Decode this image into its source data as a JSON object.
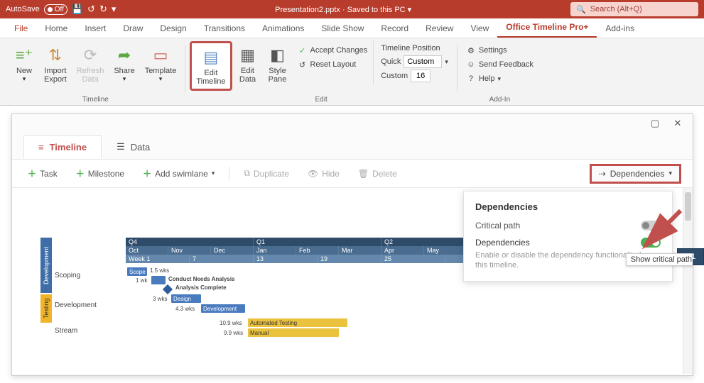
{
  "titlebar": {
    "autosave_label": "AutoSave",
    "autosave_state": "Off",
    "doc_title": "Presentation2.pptx · Saved to this PC ",
    "search_placeholder": "Search (Alt+Q)"
  },
  "ribbon_tabs": [
    "File",
    "Home",
    "Insert",
    "Draw",
    "Design",
    "Transitions",
    "Animations",
    "Slide Show",
    "Record",
    "Review",
    "View",
    "Office Timeline Pro+",
    "Add-ins"
  ],
  "ribbon": {
    "new": "New",
    "import_export": "Import\nExport",
    "refresh_data": "Refresh\nData",
    "share": "Share",
    "template": "Template",
    "group_timeline": "Timeline",
    "edit_timeline": "Edit\nTimeline",
    "edit_data": "Edit\nData",
    "style_pane": "Style\nPane",
    "accept_changes": "Accept Changes",
    "reset_layout": "Reset Layout",
    "timeline_position": "Timeline Position",
    "quick": "Quick",
    "quick_val": "Custom",
    "custom": "Custom",
    "custom_val": "16",
    "group_edit": "Edit",
    "settings": "Settings",
    "send_feedback": "Send Feedback",
    "help": "Help",
    "group_addin": "Add-In"
  },
  "editor": {
    "tab_timeline": "Timeline",
    "tab_data": "Data",
    "task": "Task",
    "milestone": "Milestone",
    "add_swimlane": "Add swimlane",
    "duplicate": "Duplicate",
    "hide": "Hide",
    "delete": "Delete",
    "dependencies_btn": "Dependencies"
  },
  "dep_popup": {
    "title": "Dependencies",
    "critical_path": "Critical path",
    "dependencies": "Dependencies",
    "desc": "Enable or disable the dependency functionality for this timeline.",
    "tooltip": "Show critical path"
  },
  "timescale": {
    "quarters": [
      "Q4",
      "Q1",
      "Q2"
    ],
    "months": [
      "Oct",
      "Nov",
      "Dec",
      "Jan",
      "Feb",
      "Mar",
      "Apr",
      "May"
    ],
    "weeks": [
      "Week 1",
      "7",
      "13",
      "19",
      "25",
      ""
    ]
  },
  "lanes": {
    "dev": "Development",
    "test": "Testing"
  },
  "rows": {
    "scoping": "Scoping",
    "development": "Development",
    "stream": "Stream"
  },
  "tasks": {
    "scope": "Scope",
    "scope_dur": "1.5 wks",
    "cna_dur": "1 wk",
    "conduct_needs": "Conduct Needs Analysis",
    "analysis_complete": "Analysis Complete",
    "design": "Design",
    "design_dur": "3 wks",
    "development": "Development",
    "dev_dur": "4.3 wks",
    "auto_test": "Automated Testing",
    "auto_dur": "10.9 wks",
    "manual": "Manual",
    "manual_dur": "9.9 wks"
  },
  "ghost": {
    "q1": "Q1"
  }
}
